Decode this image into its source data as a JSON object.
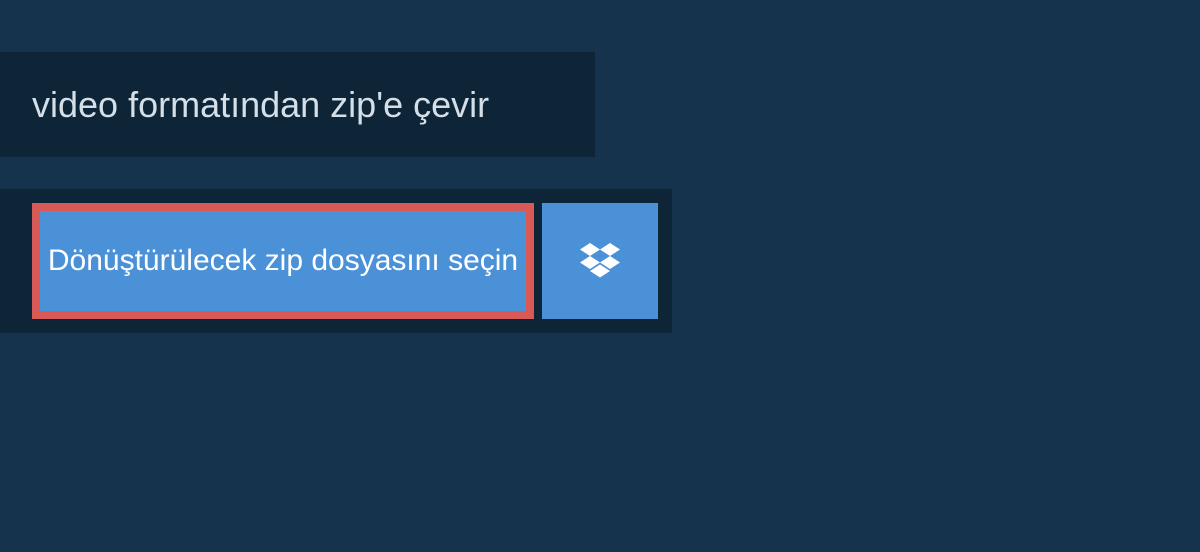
{
  "header": {
    "title": "video formatından zip'e çevir"
  },
  "actions": {
    "select_file_label": "Dönüştürülecek zip dosyasını seçin"
  },
  "colors": {
    "page_bg": "#15334c",
    "panel_bg": "#0e2538",
    "button_bg": "#4b91d7",
    "highlight_border": "#d75a56",
    "text_light": "#d4dfe8",
    "text_white": "#ffffff"
  }
}
